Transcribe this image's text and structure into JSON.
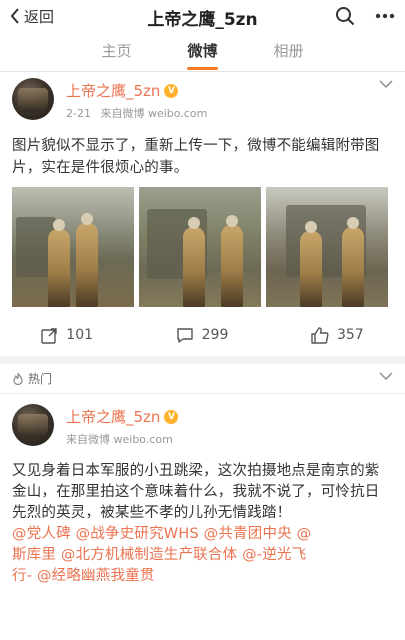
{
  "nav": {
    "back_label": "返回",
    "title": "上帝之鹰_5zn"
  },
  "tabs": [
    {
      "label": "主页",
      "active": false
    },
    {
      "label": "微博",
      "active": true
    },
    {
      "label": "相册",
      "active": false
    }
  ],
  "post1": {
    "user": "上帝之鹰_5zn",
    "date": "2-21",
    "source": "来自微博 weibo.com",
    "text": "图片貌似不显示了，重新上传一下，微博不能编辑附带图片，实在是件很烦心的事。",
    "photos": [
      "photo-1",
      "photo-2",
      "photo-3"
    ],
    "reposts": "101",
    "comments": "299",
    "likes": "357"
  },
  "hot_label": "热门",
  "post2": {
    "user": "上帝之鹰_5zn",
    "source": "来自微博 weibo.com",
    "text": "又见身着日本军服的小丑跳梁，这次拍摄地点是南京的紫金山，在那里拍这个意味着什么，我就不说了，可怜抗日先烈的英灵，被某些不孝的儿孙无情践踏！",
    "mentions_line1": "@党人碑 @战争史研究WHS @共青团中央 @",
    "mentions_line2": "斯库里 @北方机械制造生产联合体 @-逆光飞",
    "mentions_line3": "行- @经略幽燕我童贯"
  },
  "colors": {
    "accent": "#f77b25",
    "username": "#eb7350",
    "link": "#eb7350"
  }
}
